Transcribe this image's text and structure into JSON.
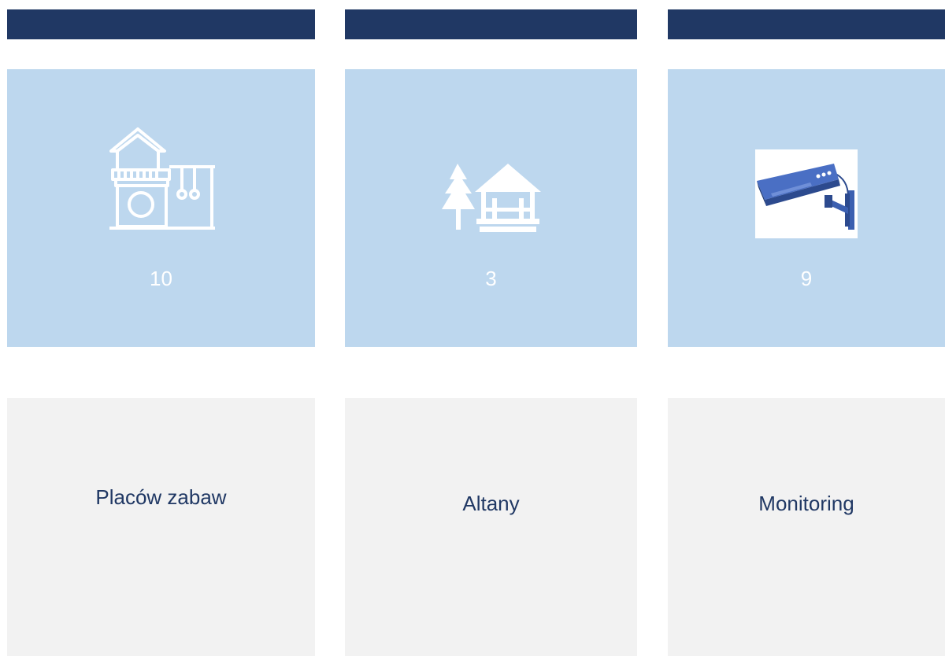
{
  "colors": {
    "header": "#203864",
    "stat_bg": "#bdd7ee",
    "label_bg": "#f2f2f2",
    "text": "#203864"
  },
  "cards": [
    {
      "icon": "playground-icon",
      "count": "10",
      "label": "Placów zabaw"
    },
    {
      "icon": "gazebo-tree-icon",
      "count": "3",
      "label": "Altany"
    },
    {
      "icon": "security-camera-icon",
      "count": "9",
      "label": "Monitoring"
    }
  ]
}
